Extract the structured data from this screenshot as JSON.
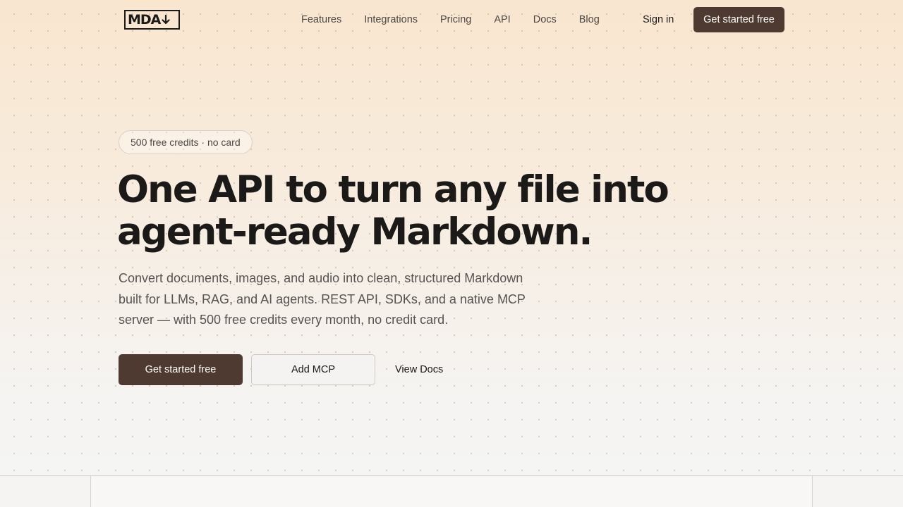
{
  "brand": {
    "logo_text": "MDA",
    "logo_icon": "down-arrow-icon"
  },
  "header": {
    "nav": [
      {
        "label": "Features"
      },
      {
        "label": "Integrations"
      },
      {
        "label": "Pricing"
      },
      {
        "label": "API"
      },
      {
        "label": "Docs"
      },
      {
        "label": "Blog"
      }
    ],
    "sign_in": "Sign in",
    "cta": "Get started free"
  },
  "hero": {
    "badge": "500 free credits · no card",
    "title_line1": "One API to turn any file into",
    "title_line2": "agent-ready Markdown.",
    "subtitle": "Convert documents, images, and audio into clean, structured Markdown built for LLMs, RAG, and AI agents. REST API, SDKs, and a native MCP server — with 500 free credits every month, no credit card.",
    "primary_cta": "Get started free",
    "secondary_cta": "Add MCP",
    "link_cta": "View Docs"
  },
  "colors": {
    "accent": "#4e3a31",
    "text": "#1c1a18",
    "muted_text": "#575350",
    "background_top": "#f9e6cf",
    "background_bottom": "#f5f5f4"
  }
}
